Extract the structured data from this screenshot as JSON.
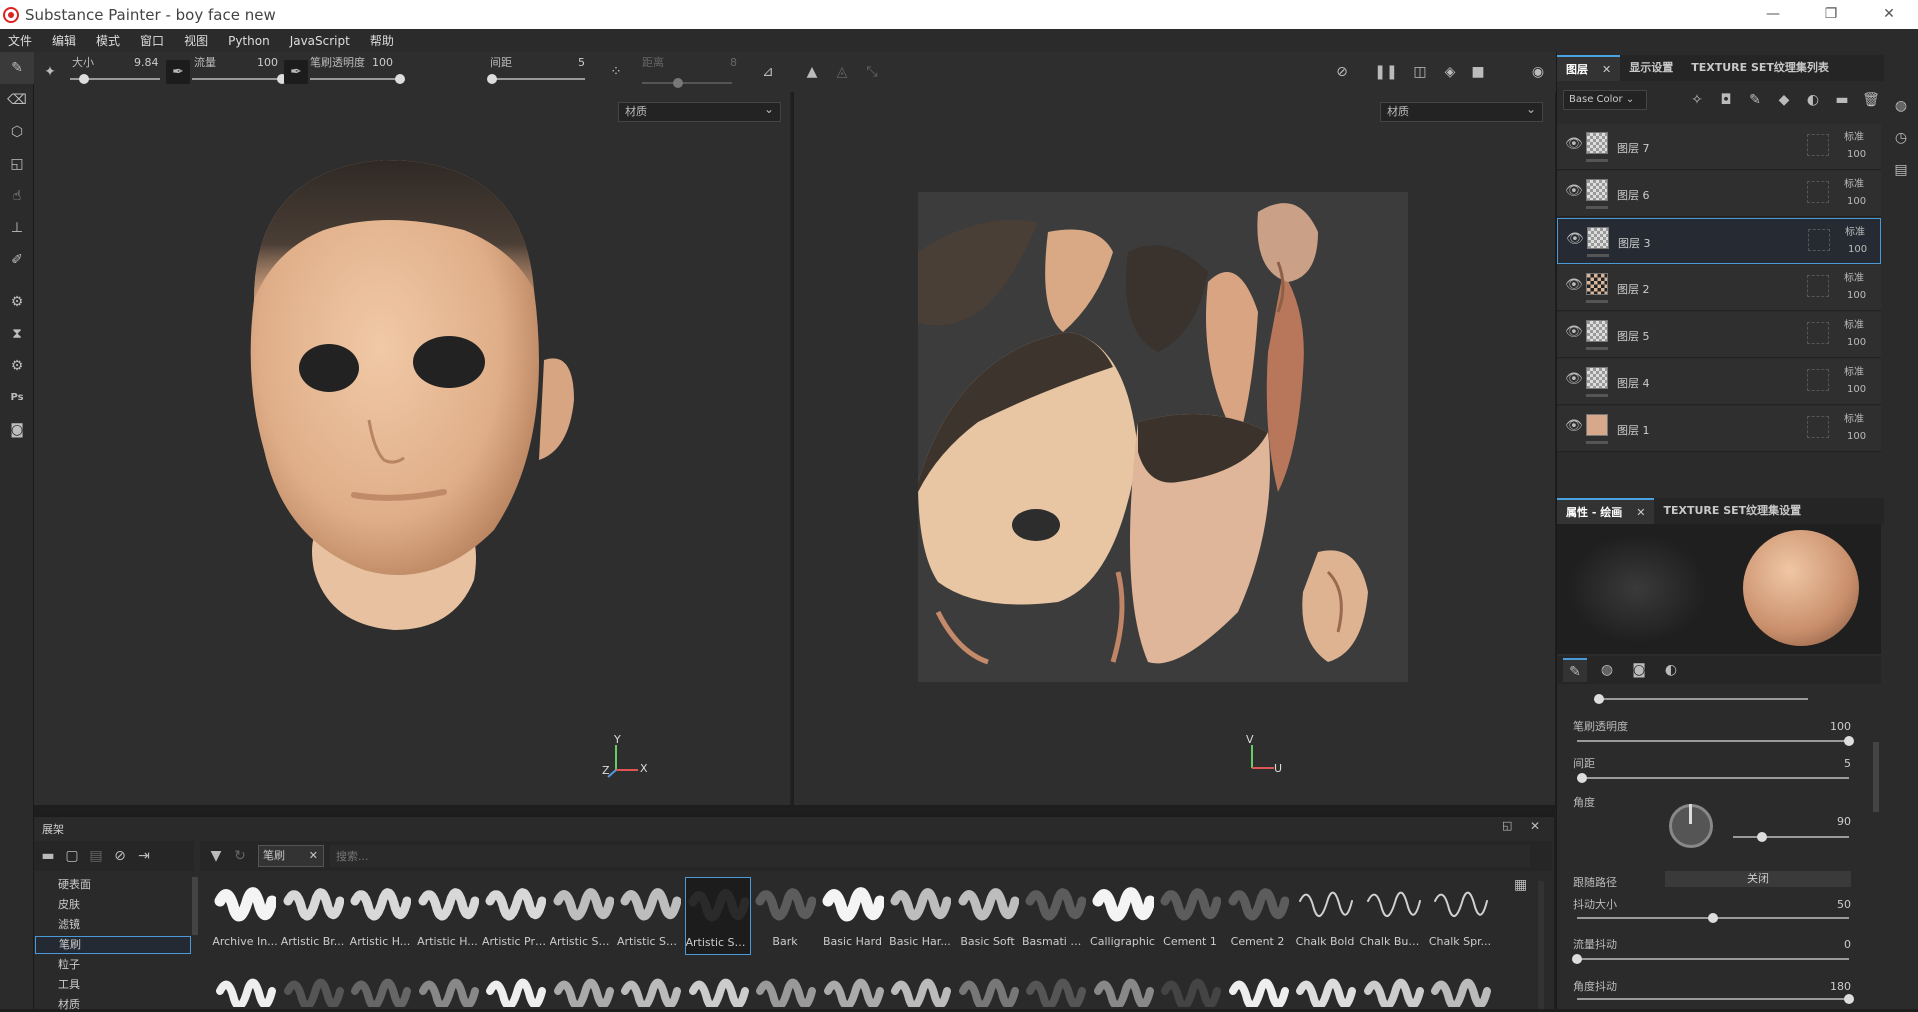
{
  "app": {
    "title": "Substance Painter - boy face new"
  },
  "window_controls": [
    "—",
    "❐",
    "✕"
  ],
  "menu": [
    "文件",
    "编辑",
    "模式",
    "窗口",
    "视图",
    "Python",
    "JavaScript",
    "帮助"
  ],
  "tool_options": {
    "size_label": "大小",
    "size_value": "9.84",
    "size_level": 0.15,
    "flow_label": "流量",
    "flow_value": "100",
    "flow_level": 1.0,
    "opacity_label": "笔刷透明度",
    "opacity_value": "100",
    "opacity_level": 1.0,
    "spacing_label": "间距",
    "spacing_value": "5",
    "spacing_level": 0.02,
    "distance_label": "距离",
    "distance_value": "8",
    "distance_level": 0.4
  },
  "viewport3d": {
    "channel": "材质",
    "axis_y": "Y",
    "axis_x": "X",
    "axis_z": "Z"
  },
  "viewport2d": {
    "channel": "材质",
    "axis_v": "V",
    "axis_u": "U"
  },
  "layers_panel": {
    "tabs": [
      {
        "label": "图层",
        "closable": true
      },
      {
        "label": "显示设置"
      },
      {
        "label": "TEXTURE SET纹理集列表"
      }
    ],
    "channel": "Base Color",
    "layers": [
      {
        "name": "图层 7",
        "blend": "标准",
        "opacity": "100",
        "selected": false
      },
      {
        "name": "图层 6",
        "blend": "标准",
        "opacity": "100",
        "selected": false
      },
      {
        "name": "图层 3",
        "blend": "标准",
        "opacity": "100",
        "selected": true
      },
      {
        "name": "图层 2",
        "blend": "标准",
        "opacity": "100",
        "selected": false
      },
      {
        "name": "图层 5",
        "blend": "标准",
        "opacity": "100",
        "selected": false
      },
      {
        "name": "图层 4",
        "blend": "标准",
        "opacity": "100",
        "selected": false
      },
      {
        "name": "图层 1",
        "blend": "标准",
        "opacity": "100",
        "selected": false
      }
    ]
  },
  "properties_panel": {
    "tabs": [
      {
        "label": "属性 - 绘画",
        "closable": true
      },
      {
        "label": "TEXTURE SET纹理集设置"
      }
    ],
    "opacity_label": "笔刷透明度",
    "opacity_value": "100",
    "opacity_level": 1.0,
    "spacing_label": "间距",
    "spacing_value": "5",
    "spacing_level": 0.02,
    "angle_label": "角度",
    "angle_value": "90",
    "angle_level": 0.25,
    "follow_path_label": "跟随路径",
    "follow_path_value": "关闭",
    "jitter_size_label": "抖动大小",
    "jitter_size_value": "50",
    "jitter_size_level": 0.5,
    "jitter_flow_label": "流量抖动",
    "jitter_flow_value": "0",
    "jitter_flow_level": 0.0,
    "jitter_angle_label": "角度抖动",
    "jitter_angle_value": "180",
    "jitter_angle_level": 1.0
  },
  "shelf": {
    "title": "展架",
    "filter_tag": "笔刷",
    "search_placeholder": "搜索...",
    "categories": [
      {
        "label": "硬表面",
        "selected": false
      },
      {
        "label": "皮肤",
        "selected": false
      },
      {
        "label": "滤镜",
        "selected": false
      },
      {
        "label": "笔刷",
        "selected": true
      },
      {
        "label": "粒子",
        "selected": false
      },
      {
        "label": "工具",
        "selected": false
      },
      {
        "label": "材质",
        "selected": false
      }
    ],
    "brushes": [
      {
        "label": "Archive In...",
        "style": "hard",
        "selected": false
      },
      {
        "label": "Artistic Br...",
        "style": "rough",
        "selected": false
      },
      {
        "label": "Artistic H...",
        "style": "rough",
        "selected": false
      },
      {
        "label": "Artistic H...",
        "style": "rough",
        "selected": false
      },
      {
        "label": "Artistic Pri...",
        "style": "rough",
        "selected": false
      },
      {
        "label": "Artistic So...",
        "style": "soft",
        "selected": false
      },
      {
        "label": "Artistic So...",
        "style": "soft",
        "selected": false
      },
      {
        "label": "Artistic So...",
        "style": "dark",
        "selected": true
      },
      {
        "label": "Bark",
        "style": "faint",
        "selected": false
      },
      {
        "label": "Basic Hard",
        "style": "hard",
        "selected": false
      },
      {
        "label": "Basic Har...",
        "style": "soft",
        "selected": false
      },
      {
        "label": "Basic Soft",
        "style": "soft",
        "selected": false
      },
      {
        "label": "Basmati B...",
        "style": "faint",
        "selected": false
      },
      {
        "label": "Calligraphic",
        "style": "hard",
        "selected": false
      },
      {
        "label": "Cement 1",
        "style": "faint",
        "selected": false
      },
      {
        "label": "Cement 2",
        "style": "faint",
        "selected": false
      },
      {
        "label": "Chalk Bold",
        "style": "thin",
        "selected": false
      },
      {
        "label": "Chalk Bum...",
        "style": "thin",
        "selected": false
      },
      {
        "label": "Chalk Spr...",
        "style": "thin",
        "selected": false
      }
    ]
  },
  "colors": {
    "accent": "#4a9ad8",
    "skin": "#e6b894",
    "hair": "#3a332d",
    "panel": "#2b2b2b",
    "viewport": "#2e2e2e"
  }
}
